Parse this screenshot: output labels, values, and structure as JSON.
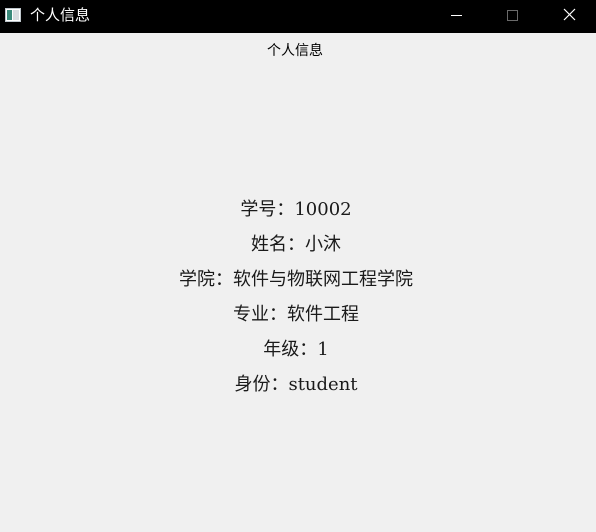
{
  "window": {
    "title": "个人信息",
    "icon": "app-window-icon",
    "controls": {
      "minimize_icon": "minimize-icon",
      "maximize_icon": "maximize-icon",
      "close_icon": "close-icon"
    }
  },
  "heading": "个人信息",
  "info": {
    "student_id": "学号：10002",
    "name": "姓名：小沐",
    "college": "学院：软件与物联网工程学院",
    "major": "专业：软件工程",
    "grade": "年级：1",
    "role": "身份：student"
  },
  "colors": {
    "titlebar_bg": "#000000",
    "titlebar_text": "#ffffff",
    "window_bg": "#f0f0f0",
    "text": "#1a1a1a"
  }
}
